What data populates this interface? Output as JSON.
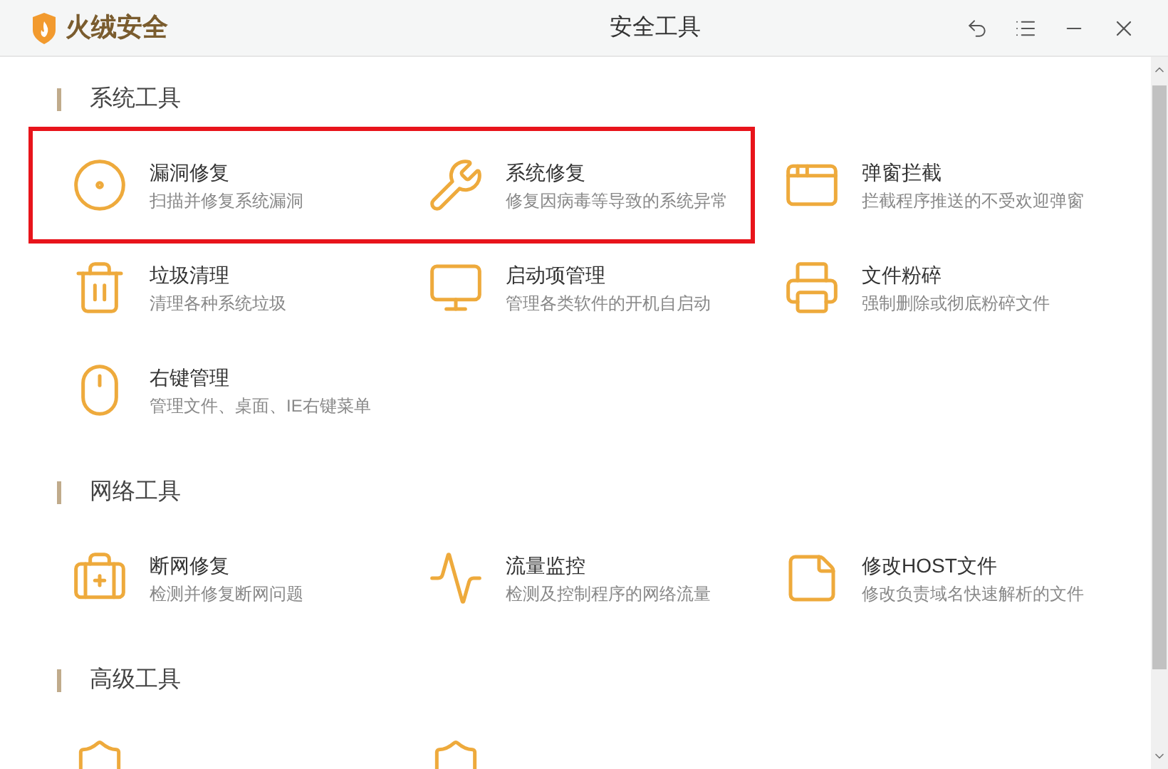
{
  "app": {
    "name": "火绒安全"
  },
  "window": {
    "title": "安全工具"
  },
  "sections": [
    {
      "title": "系统工具",
      "items": [
        {
          "title": "漏洞修复",
          "desc": "扫描并修复系统漏洞",
          "highlighted": true
        },
        {
          "title": "系统修复",
          "desc": "修复因病毒等导致的系统异常",
          "highlighted": true
        },
        {
          "title": "弹窗拦截",
          "desc": "拦截程序推送的不受欢迎弹窗",
          "highlighted": false
        },
        {
          "title": "垃圾清理",
          "desc": "清理各种系统垃圾",
          "highlighted": false
        },
        {
          "title": "启动项管理",
          "desc": "管理各类软件的开机自启动",
          "highlighted": false
        },
        {
          "title": "文件粉碎",
          "desc": "强制删除或彻底粉碎文件",
          "highlighted": false
        },
        {
          "title": "右键管理",
          "desc": "管理文件、桌面、IE右键菜单",
          "highlighted": false
        }
      ]
    },
    {
      "title": "网络工具",
      "items": [
        {
          "title": "断网修复",
          "desc": "检测并修复断网问题",
          "highlighted": false
        },
        {
          "title": "流量监控",
          "desc": "检测及控制程序的网络流量",
          "highlighted": false
        },
        {
          "title": "修改HOST文件",
          "desc": "修改负责域名快速解析的文件",
          "highlighted": false
        }
      ]
    },
    {
      "title": "高级工具"
    }
  ]
}
